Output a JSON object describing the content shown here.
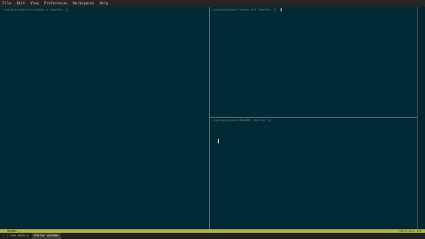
{
  "menu": {
    "items": [
      "File",
      "Edit",
      "View",
      "Preferences",
      "Workspaces",
      "Help"
    ]
  },
  "panes": {
    "left_title": "~/work/project/src/main.c  [buffer 1]",
    "top_right_title": "~/work/project/notes.txt  [buffer 2]",
    "bottom_right_title": "~/work/project/README  [buffer 3]"
  },
  "status": {
    "left": "-- NORMAL --",
    "right": "utf-8  unix  0:0"
  },
  "taskbar": {
    "items": [
      {
        "label": "~ : vim main.c",
        "active": false
      },
      {
        "label": "Editor window",
        "active": true
      }
    ]
  },
  "colors": {
    "background": "#002b36",
    "statusline": "#b5b53a",
    "divider": "#586e75"
  }
}
